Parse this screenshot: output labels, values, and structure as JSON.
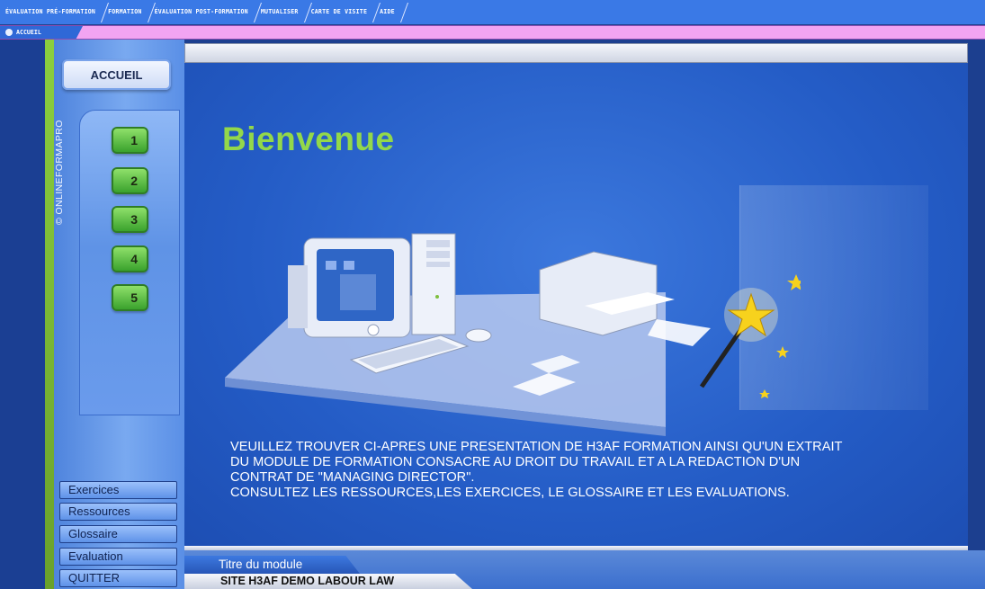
{
  "top_menu": {
    "items": [
      "ÉVALUATION PRÉ-FORMATION",
      "FORMATION",
      "ÉVALUATION POST-FORMATION",
      "MUTUALISER",
      "CARTE DE VISITE",
      "AIDE"
    ]
  },
  "breadcrumb": {
    "label": "ACCUEIL",
    "icon": "home-icon"
  },
  "sidebar": {
    "home_button": "ACCUEIL",
    "copyright": "© ONLINEFORMAPRO",
    "steps": [
      "1",
      "2",
      "3",
      "4",
      "5"
    ],
    "nav_items": [
      "Exercices",
      "Ressources",
      "Glossaire",
      "Evaluation",
      "QUITTER"
    ]
  },
  "main": {
    "title": "Bienvenue",
    "intro_lines": [
      "VEUILLEZ TROUVER CI-APRES UNE PRESENTATION DE H3AF FORMATION AINSI QU'UN EXTRAIT",
      "DU MODULE DE FORMATION CONSACRE AU DROIT DU TRAVAIL ET A LA REDACTION D'UN",
      "CONTRAT DE \"MANAGING DIRECTOR\".",
      "CONSULTEZ LES RESSOURCES,LES EXERCICES, LE GLOSSAIRE ET LES EVALUATIONS."
    ]
  },
  "footer": {
    "module_tab": "Titre du module",
    "site_tab": "SITE H3AF DEMO LABOUR LAW"
  },
  "colors": {
    "title_green": "#93d84a",
    "step_green": "#3aa22d",
    "menu_blue": "#3a79e6",
    "breadcrumb_pink": "#f2a4f2"
  }
}
